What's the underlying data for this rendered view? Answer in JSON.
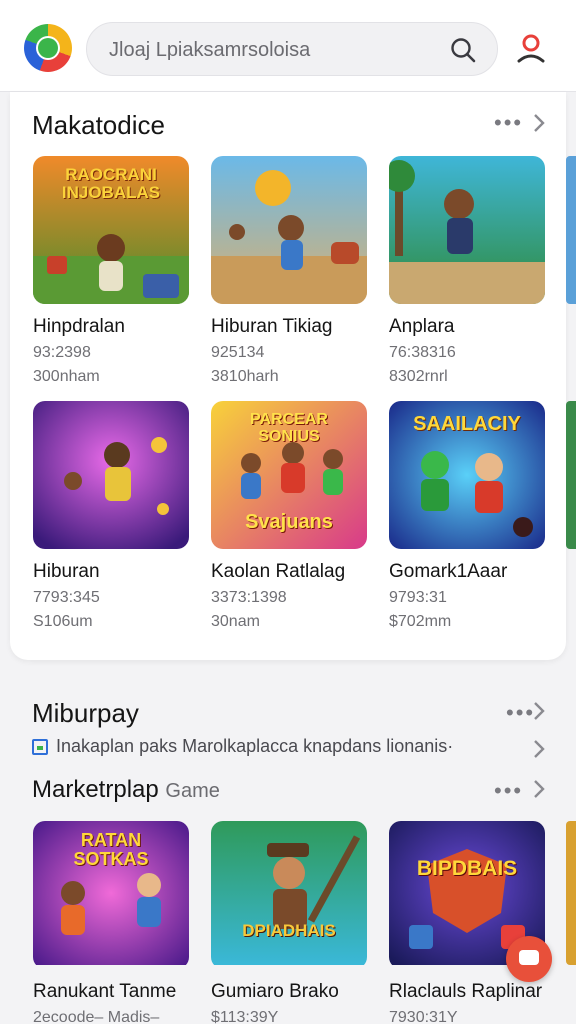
{
  "search": {
    "query": "Jloaj Lpiaksamrsoloisa"
  },
  "section1": {
    "title": "Makatodice",
    "more": "•••",
    "row1": [
      {
        "name": "Hinpdralan",
        "meta1": "93:2398",
        "meta2": "300nham",
        "thumb_text": "RAOCRANI INJOBALAS"
      },
      {
        "name": "Hiburan Tikiag",
        "meta1": "925134",
        "meta2": "3810harh",
        "thumb_text": ""
      },
      {
        "name": "Anplara",
        "meta1": "76:38316",
        "meta2": "8302rnrl",
        "thumb_text": ""
      }
    ],
    "row2": [
      {
        "name": "Hiburan",
        "meta1": "7793:345",
        "meta2": "S106um",
        "thumb_text": ""
      },
      {
        "name": "Kaolan Ratlalag",
        "meta1": "3373:1398",
        "meta2": "30nam",
        "thumb_text": "PARCEAR SONIUS",
        "thumb_text2": "Svajuans"
      },
      {
        "name": "Gomark1Aaar",
        "meta1": "9793:31",
        "meta2": "$702mm",
        "thumb_text": "SAAILACIY"
      }
    ]
  },
  "section2": {
    "title": "Miburpay",
    "more": "•••",
    "notice": "Inakaplan paks Marolkaplacca knapdans lionanis·"
  },
  "section3": {
    "title": "Marketrplap",
    "subtitle": "Game",
    "more": "•••",
    "row": [
      {
        "name": "Ranukant Tanme",
        "meta1": "2ecoode– Madis–",
        "thumb_text": "RATAN SOTKAS"
      },
      {
        "name": "Gumiaro Brako",
        "meta1": "$113:39Y",
        "thumb_text": "DPIADHAIS"
      },
      {
        "name": "Rlaclauls Raplinar",
        "meta1": "7930:31Y",
        "thumb_text": "BIPDBAIS"
      }
    ]
  },
  "colors": {
    "accent": "#e8503a",
    "link_blue": "#2e6fd8",
    "brand_green": "#3bb54a"
  }
}
